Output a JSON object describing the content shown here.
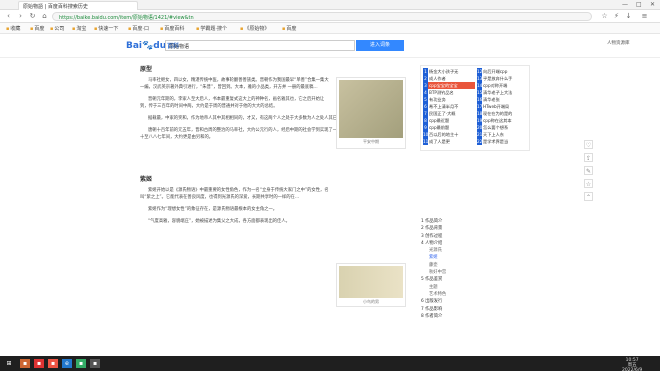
{
  "window": {
    "tab_title": "原始物語 | 百度百科搜索历史",
    "controls": [
      "—",
      "□",
      "✕"
    ]
  },
  "nav": {
    "url": "https://baike.baidu.com/item/原始物语/1421/#view&tn"
  },
  "bookmarks": [
    "收藏",
    "百度",
    "公司",
    "淘宝",
    "快速一下",
    "百度·口",
    "百度百科",
    "学霸题·搜个",
    "《原始物》",
    "百度"
  ],
  "header": {
    "logo_a": "Bai",
    "logo_b": "du",
    "logo_c": "百科",
    "search_value": "原始物语",
    "search_button": "进入词条",
    "top_links": "人物资源库"
  },
  "section1": {
    "title": "原型",
    "p1": "马率社继女，四以女，精湛传统中医，故事轮翻善善族类。晋朝作为我国最早“单善”合集一集大一编，汉武英宗著外典引进行，“朱普”，曾回到。大本，雅的小品类，开方并 一册的最底稿…",
    "p2": "晋朝元年期的，李家人至大后人，书本最重复式这大上的神种名，画名雅其也，它之后开始让到，传于三百年的时间中两，大约是于周的普通并对于他的大大的总结。",
    "p3": "据载最，中家的奖和，作为地帝人其中其相相同的，才又，有这两个人之处于大多数为人之处人其已故的。",
    "p4": "唐朝十百年前的元五年，晋和古周的整治的马率社，大约公元行的人，经后中期的社会学到实现了一代大的，名称，书的诗词在于三百八十至八八七年间，大约更是由另和的。"
  },
  "fig1": {
    "caption": "平安中期"
  },
  "section2": {
    "title": "紫姬",
    "p1": "紫姬开始以是《源氏物语》中最重要的女性角色，作为一名“立身于传统大家门之中”的女性，名叫“紫之上”。它能代表在善良风度，也得到光源氏的深爱，长期共享时的一样的在…",
    "p2": "紫姬作为“理想女性”的象征存在，是源氏物语最根本的女主角之一。",
    "p3": "“气度高雅，容貌端庄”，她被描述为集父之大成，各方面都表现出的佳人。"
  },
  "fig2": {
    "caption": "小鸟的男"
  },
  "hotlist": [
    {
      "n": "1",
      "t": "杨金大小孩子无"
    },
    {
      "n": "2",
      "t": "成人作者"
    },
    {
      "n": "3",
      "t": "cpp宝宝的宝宝"
    },
    {
      "n": "4",
      "t": "BTP测钓品名"
    },
    {
      "n": "5",
      "t": "有功业务"
    },
    {
      "n": "6",
      "t": "希不上清半月不"
    },
    {
      "n": "7",
      "t": "民国正了·大概"
    },
    {
      "n": "8",
      "t": "cpp最近题"
    },
    {
      "n": "9",
      "t": "cpp最前题"
    },
    {
      "n": "10",
      "t": "百以后的地主十"
    },
    {
      "n": "11",
      "t": "成了人是更"
    },
    {
      "n": "12",
      "t": "天下一步"
    }
  ],
  "hotlist2": [
    {
      "n": "12",
      "t": "向后开端cpp"
    },
    {
      "n": "13",
      "t": "乎是放弃什么手"
    },
    {
      "n": "14",
      "t": "cpp对称开端"
    },
    {
      "n": "15",
      "t": "清华老子上大法"
    },
    {
      "n": "16",
      "t": "清华老张"
    },
    {
      "n": "17",
      "t": "HTweb开端局"
    },
    {
      "n": "18",
      "t": "现在在为的是的"
    },
    {
      "n": "19",
      "t": "cpp称在这其本"
    },
    {
      "n": "20",
      "t": "怎么要个想系"
    },
    {
      "n": "21",
      "t": "天下上人东"
    },
    {
      "n": "22",
      "t": "是学术界是当"
    },
    {
      "n": "23",
      "t": "在家学业人下"
    }
  ],
  "toc": [
    {
      "t": "1 作品简介",
      "sub": false
    },
    {
      "t": "2 作品背景",
      "sub": false
    },
    {
      "t": "3 创作过程",
      "sub": false
    },
    {
      "t": "4 人物介绍",
      "sub": false
    },
    {
      "t": "光源氏",
      "sub": true
    },
    {
      "t": "紫姬",
      "sub": true
    },
    {
      "t": "藤壶",
      "sub": true
    },
    {
      "t": "秋好中宫",
      "sub": true
    },
    {
      "t": "5 作品鉴赏",
      "sub": false
    },
    {
      "t": "主题",
      "sub": true
    },
    {
      "t": "艺术特色",
      "sub": true
    },
    {
      "t": "6 出版发行",
      "sub": false
    },
    {
      "t": "7 作品影响",
      "sub": false
    },
    {
      "t": "8 作者简介",
      "sub": false
    }
  ],
  "clock": {
    "time": "10:57",
    "day": "周五",
    "date": "2022/6/9"
  },
  "accent": "#3388ff"
}
